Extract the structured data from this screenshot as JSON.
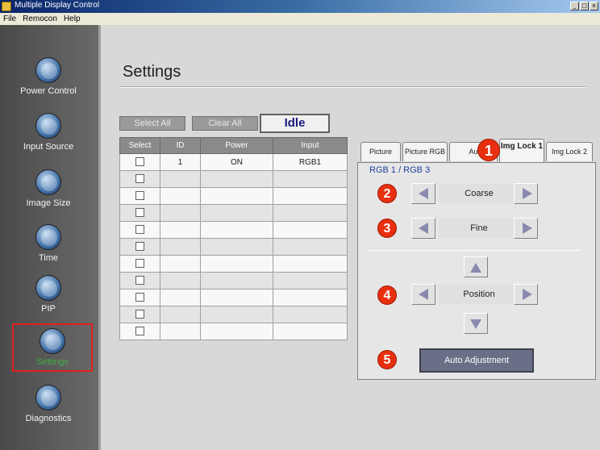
{
  "window": {
    "title": "Multiple Display Control",
    "controls": [
      "_",
      "□",
      "x"
    ]
  },
  "menu": [
    "File",
    "Remocon",
    "Help"
  ],
  "sidebar": {
    "items": [
      {
        "label": "Power Control",
        "icon": "power-icon"
      },
      {
        "label": "Input Source",
        "icon": "plug-icon"
      },
      {
        "label": "Image Size",
        "icon": "monitor-icon"
      },
      {
        "label": "Time",
        "icon": "clock-icon"
      },
      {
        "label": "PIP",
        "icon": "pip-icon"
      },
      {
        "label": "Settings",
        "icon": "wrench-icon",
        "active": true
      },
      {
        "label": "Diagnostics",
        "icon": "clipboard-icon"
      }
    ]
  },
  "main": {
    "title": "Settings",
    "toolbar": {
      "select_all": "Select All",
      "clear_all": "Clear All",
      "status": "Idle"
    },
    "table": {
      "headers": [
        "Select",
        "ID",
        "Power",
        "Input"
      ],
      "rows": [
        {
          "id": "1",
          "power": "ON",
          "input": "RGB1"
        },
        {
          "id": "",
          "power": "",
          "input": ""
        },
        {
          "id": "",
          "power": "",
          "input": ""
        },
        {
          "id": "",
          "power": "",
          "input": ""
        },
        {
          "id": "",
          "power": "",
          "input": ""
        },
        {
          "id": "",
          "power": "",
          "input": ""
        },
        {
          "id": "",
          "power": "",
          "input": ""
        },
        {
          "id": "",
          "power": "",
          "input": ""
        },
        {
          "id": "",
          "power": "",
          "input": ""
        },
        {
          "id": "",
          "power": "",
          "input": ""
        },
        {
          "id": "",
          "power": "",
          "input": ""
        }
      ]
    }
  },
  "panel": {
    "tabs": [
      "Picture",
      "Picture RGB",
      "Au",
      "Img Lock 1",
      "Img Lock 2"
    ],
    "active_tab": "Img Lock 1",
    "subtitle": "RGB 1 / RGB 3",
    "coarse": "Coarse",
    "fine": "Fine",
    "position": "Position",
    "auto": "Auto Adjustment"
  },
  "badges": [
    "1",
    "2",
    "3",
    "4",
    "5"
  ],
  "colors": {
    "badge": "#e83010",
    "active_outline": "#e02020",
    "active_label": "#40b040",
    "status_text": "#1a1a80"
  }
}
